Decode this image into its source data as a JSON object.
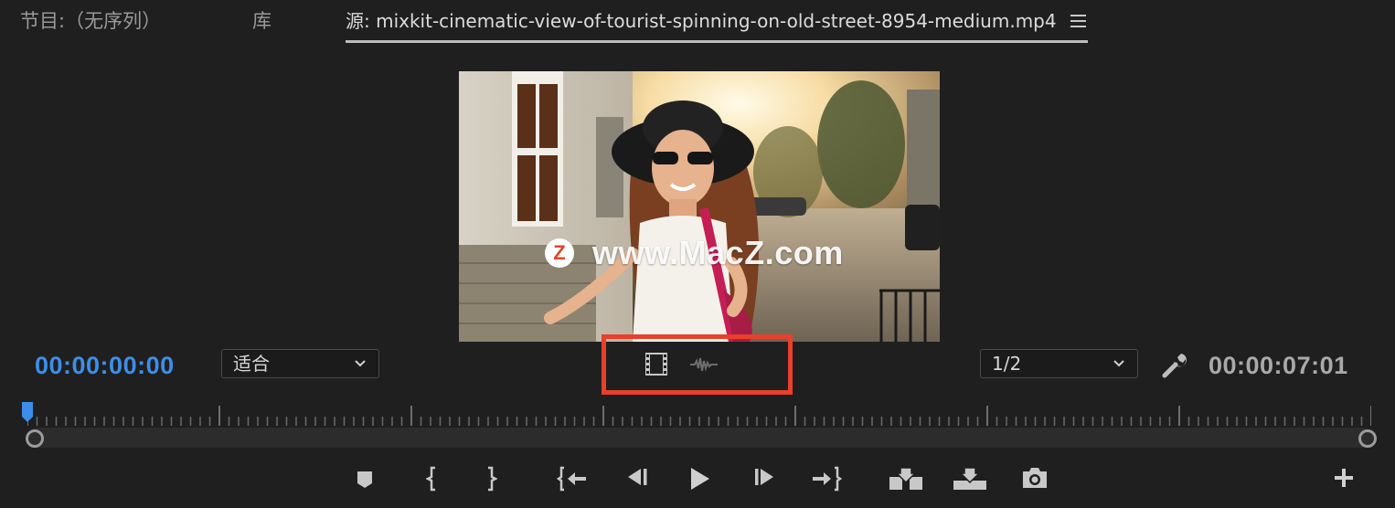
{
  "tabs": {
    "program_label": "节目:（无序列）",
    "library_label": "库",
    "source_label": "源: mixkit-cinematic-view-of-tourist-spinning-on-old-street-8954-medium.mp4"
  },
  "watermark": {
    "logo_letter": "Z",
    "text": "www.MacZ.com"
  },
  "timecodes": {
    "current": "00:00:00:00",
    "duration": "00:00:07:01"
  },
  "zoom_dropdown": {
    "selected": "适合"
  },
  "resolution_dropdown": {
    "selected": "1/2"
  },
  "colors": {
    "accent_blue": "#3d8ee8",
    "highlight_red": "#e8402a",
    "panel_bg": "#1f1f1f"
  },
  "icons": {
    "tab_menu": "hamburger-menu-icon",
    "drag_video": "film-strip-icon",
    "drag_audio": "audio-waveform-icon",
    "settings": "wrench-icon",
    "transport": [
      "add-marker-icon",
      "mark-in-icon",
      "mark-out-icon",
      "go-to-in-icon",
      "step-back-icon",
      "play-icon",
      "step-forward-icon",
      "go-to-out-icon",
      "insert-icon",
      "overwrite-icon",
      "export-frame-icon",
      "add-button-icon"
    ]
  },
  "playhead_position": 0
}
